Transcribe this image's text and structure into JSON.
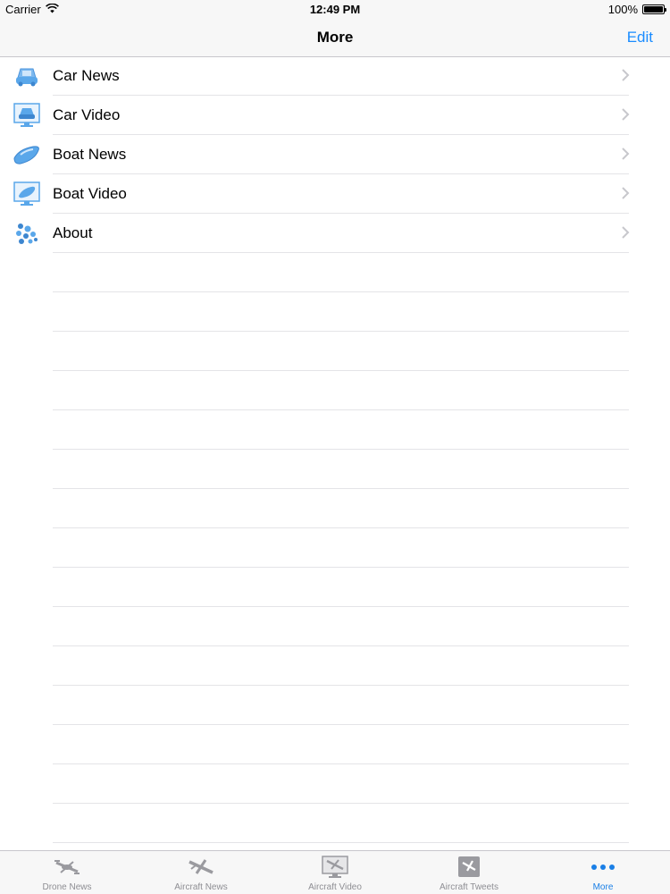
{
  "status_bar": {
    "carrier": "Carrier",
    "time": "12:49 PM",
    "battery": "100%"
  },
  "nav": {
    "title": "More",
    "edit_label": "Edit"
  },
  "rows": [
    {
      "label": "Car News",
      "icon": "car-news-icon"
    },
    {
      "label": "Car Video",
      "icon": "car-video-icon"
    },
    {
      "label": "Boat News",
      "icon": "boat-news-icon"
    },
    {
      "label": "Boat Video",
      "icon": "boat-video-icon"
    },
    {
      "label": "About",
      "icon": "about-icon"
    }
  ],
  "tabs": [
    {
      "label": "Drone News",
      "icon": "drone-icon",
      "active": false
    },
    {
      "label": "Aircraft News",
      "icon": "aircraft-icon",
      "active": false
    },
    {
      "label": "Aircraft Video",
      "icon": "aircraft-video-icon",
      "active": false
    },
    {
      "label": "Aircraft Tweets",
      "icon": "aircraft-tweets-icon",
      "active": false
    },
    {
      "label": "More",
      "icon": "more-icon",
      "active": true
    }
  ],
  "colors": {
    "accent": "#1a8cff",
    "icon_blue": "#5aa7ea",
    "inactive_tab": "#8e8e93"
  }
}
